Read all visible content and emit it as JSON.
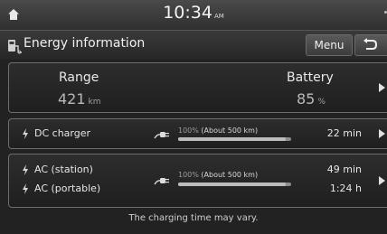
{
  "status_bar": {
    "time": "10:34",
    "ampm": "AM"
  },
  "title_bar": {
    "title": "Energy information",
    "menu_label": "Menu"
  },
  "summary": {
    "range_label": "Range",
    "range_value": "421",
    "range_unit": "km",
    "battery_label": "Battery",
    "battery_value": "85",
    "battery_unit": "%"
  },
  "dc_charger": {
    "label": "DC charger",
    "percent": "100%",
    "about": "(About 500 km)",
    "progress": 0.95,
    "time": "22 min"
  },
  "ac_charging": {
    "station_label": "AC (station)",
    "portable_label": "AC (portable)",
    "percent": "100%",
    "about": "(About 500 km)",
    "progress": 0.95,
    "station_time": "49 min",
    "portable_time": "1:24 h"
  },
  "footnote": "The charging time may vary.",
  "icons": [
    "home-icon",
    "ev-charge-icon",
    "back-icon",
    "bolt-icon",
    "plug-icon",
    "arrow-right-icon"
  ]
}
